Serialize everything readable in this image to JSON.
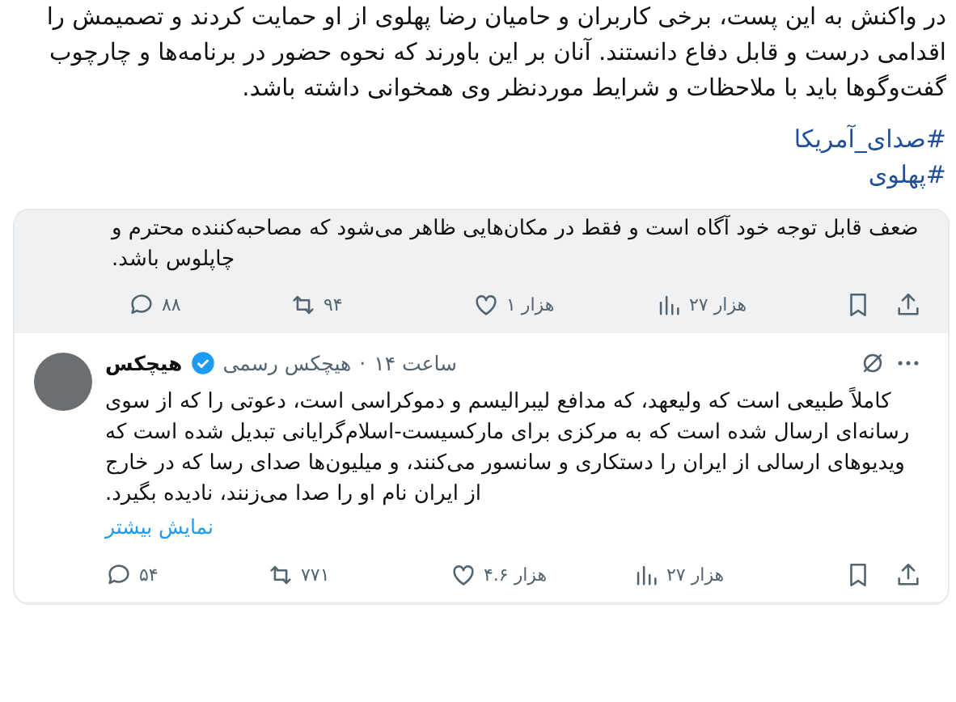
{
  "article": {
    "paragraph": "در واکنش به این پست، برخی کاربران و حامیان رضا پهلوی از او حمایت کردند و تصمیمش را اقدامی درست و قابل دفاع دانستند. آنان بر این باورند که نحوه حضور در برنامه‌ها و چارچوب گفت‌وگوها باید با ملاحظات و شرایط موردنظر وی همخوانی داشته باشد.",
    "hashtags": [
      "#صدای_آمریکا",
      "#پهلوی"
    ]
  },
  "tweets": [
    {
      "kind": "partial",
      "text": "ضعف قابل توجه خود آگاه است و فقط در مکان‌هایی ظاهر می‌شود که مصاحبه‌کننده محترم و چاپلوس باشد.",
      "highlighted": true,
      "actions": {
        "replies": "۸۸",
        "reposts": "۹۴",
        "likes": "۱ هزار",
        "views": "۲۷ هزار"
      }
    },
    {
      "kind": "full",
      "name": "هیچکس",
      "verified": true,
      "handle": "هیچکس رسمی",
      "separator": "·",
      "time": "۱۴ ساعت",
      "highlighted": false,
      "text": "کاملاً طبیعی است که ولیعهد، که مدافع لیبرالیسم و دموکراسی است، دعوتی را که از سوی رسانه‌ای ارسال شده است که به مرکزی برای مارکسیست-اسلام‌گرایانی تبدیل شده است که ویدیوهای ارسالی از ایران را دستکاری و سانسور می‌کنند، و میلیون‌ها صدای رسا که در خارج از ایران نام او را صدا می‌زنند، نادیده بگیرد.",
      "show_more": "نمایش بیشتر",
      "actions": {
        "replies": "۵۴",
        "reposts": "۷۷۱",
        "likes": "۴.۶ هزار",
        "views": "۲۷ هزار"
      }
    }
  ]
}
